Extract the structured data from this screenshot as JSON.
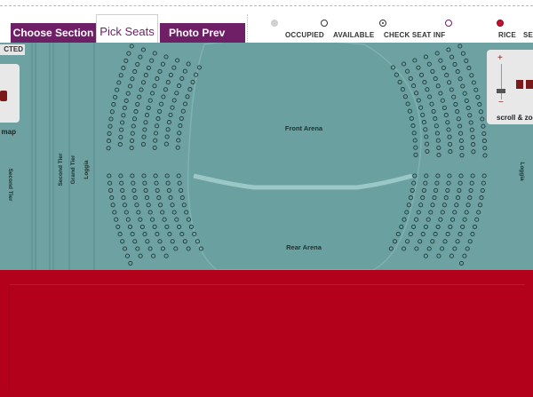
{
  "tabs": {
    "choose_section": "Choose Section",
    "pick_seats": "Pick Seats",
    "photo_preview": "Photo Prev"
  },
  "legend": {
    "occupied": "OCCUPIED",
    "available": "AVAILABLE",
    "check_seat_info": "CHECK SEAT INF",
    "price": "RICE",
    "price_b": "SE"
  },
  "left_panel": {
    "header": "CTED",
    "map_label": "map"
  },
  "zoom": {
    "plus": "+",
    "minus": "−",
    "label": "scroll & zoom"
  },
  "map_labels": {
    "front_arena": "Front Arena",
    "rear_arena": "Rear Arena",
    "second_tier_left": "Second Tier",
    "second_tier": "Second Tier",
    "grand_tier": "Grand Tier",
    "loggia_left": "Loggia",
    "loggia_right": "Loggia"
  },
  "colors": {
    "brand_purple": "#6e1f66",
    "map_teal": "#6ea2a2",
    "seat_outline": "#1f3a3a",
    "selected_seat": "#c8102e",
    "footer_red": "#b3001b"
  }
}
